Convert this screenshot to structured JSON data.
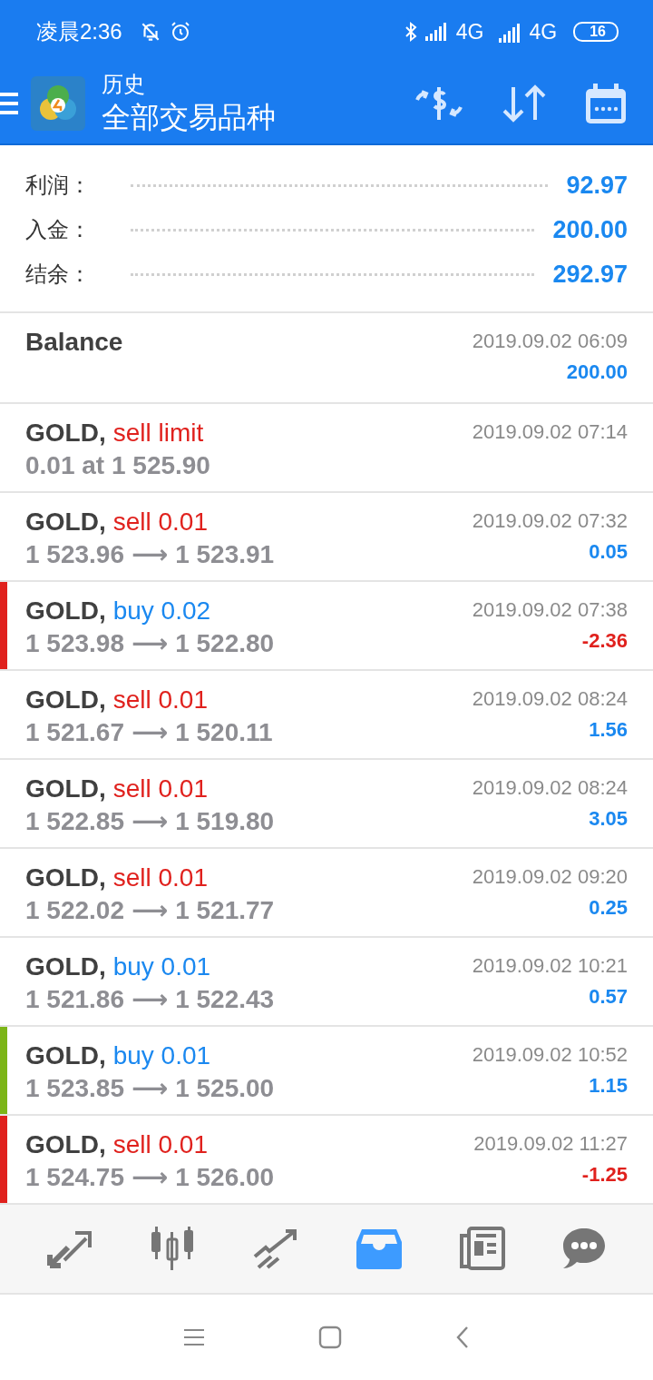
{
  "status_bar": {
    "time": "凌晨2:36",
    "network_1": "4G",
    "network_2": "4G",
    "battery": "16"
  },
  "header": {
    "title": "历史",
    "subtitle": "全部交易品种"
  },
  "summary": [
    {
      "label": "利润：",
      "value": "92.97"
    },
    {
      "label": "入金：",
      "value": "200.00"
    },
    {
      "label": "结余：",
      "value": "292.97"
    }
  ],
  "rows": [
    {
      "kind": "balance",
      "symbol": "Balance",
      "time": "2019.09.02 06:09",
      "amount": "200.00",
      "loss": false
    },
    {
      "kind": "order",
      "symbol": "GOLD,",
      "action": "sell limit",
      "buy": false,
      "detail": "0.01 at 1 525.90",
      "time": "2019.09.02 07:14"
    },
    {
      "kind": "deal",
      "symbol": "GOLD,",
      "action": "sell 0.01",
      "buy": false,
      "open": "1 523.96",
      "arrow": "⟶",
      "close": "1 523.91",
      "time": "2019.09.02 07:32",
      "amount": "0.05",
      "loss": false
    },
    {
      "kind": "deal",
      "symbol": "GOLD,",
      "action": "buy 0.02",
      "buy": true,
      "open": "1 523.98",
      "arrow": "⟶",
      "close": "1 522.80",
      "time": "2019.09.02 07:38",
      "amount": "-2.36",
      "loss": true,
      "color": "#e0211d"
    },
    {
      "kind": "deal",
      "symbol": "GOLD,",
      "action": "sell 0.01",
      "buy": false,
      "open": "1 521.67",
      "arrow": "⟶",
      "close": "1 520.11",
      "time": "2019.09.02 08:24",
      "amount": "1.56",
      "loss": false
    },
    {
      "kind": "deal",
      "symbol": "GOLD,",
      "action": "sell 0.01",
      "buy": false,
      "open": "1 522.85",
      "arrow": "⟶",
      "close": "1 519.80",
      "time": "2019.09.02 08:24",
      "amount": "3.05",
      "loss": false
    },
    {
      "kind": "deal",
      "symbol": "GOLD,",
      "action": "sell 0.01",
      "buy": false,
      "open": "1 522.02",
      "arrow": "⟶",
      "close": "1 521.77",
      "time": "2019.09.02 09:20",
      "amount": "0.25",
      "loss": false
    },
    {
      "kind": "deal",
      "symbol": "GOLD,",
      "action": "buy 0.01",
      "buy": true,
      "open": "1 521.86",
      "arrow": "⟶",
      "close": "1 522.43",
      "time": "2019.09.02 10:21",
      "amount": "0.57",
      "loss": false
    },
    {
      "kind": "deal",
      "symbol": "GOLD,",
      "action": "buy 0.01",
      "buy": true,
      "open": "1 523.85",
      "arrow": "⟶",
      "close": "1 525.00",
      "time": "2019.09.02 10:52",
      "amount": "1.15",
      "loss": false,
      "color": "#7cb518"
    },
    {
      "kind": "deal",
      "symbol": "GOLD,",
      "action": "sell 0.01",
      "buy": false,
      "open": "1 524.75",
      "arrow": "⟶",
      "close": "1 526.00",
      "time": "2019.09.02 11:27",
      "amount": "-1.25",
      "loss": true,
      "color": "#e0211d"
    }
  ],
  "bottom_nav": [
    {
      "kind": "quotes",
      "selected": false
    },
    {
      "kind": "chart",
      "selected": false
    },
    {
      "kind": "trade",
      "selected": false
    },
    {
      "kind": "history",
      "selected": true
    },
    {
      "kind": "news",
      "selected": false
    },
    {
      "kind": "chat",
      "selected": false
    }
  ]
}
